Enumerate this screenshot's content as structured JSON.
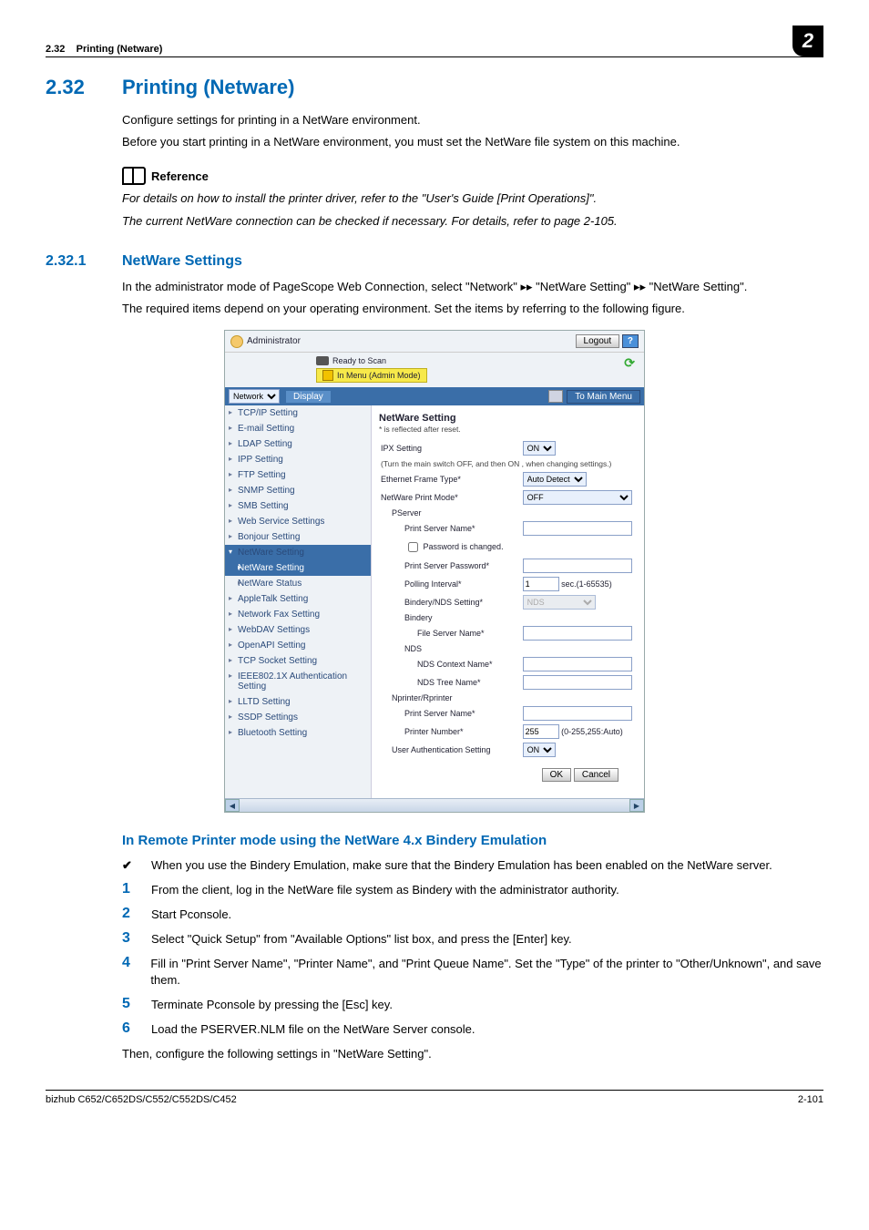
{
  "header": {
    "section_no": "2.32",
    "section_name": "Printing (Netware)",
    "chapter_badge": "2"
  },
  "h1": {
    "num": "2.32",
    "title": "Printing (Netware)"
  },
  "intro": {
    "p1": "Configure settings for printing in a NetWare environment.",
    "p2": "Before you start printing in a NetWare environment, you must set the NetWare file system on this machine."
  },
  "reference": {
    "label": "Reference",
    "l1": "For details on how to install the printer driver, refer to the \"User's Guide [Print Operations]\".",
    "l2": "The current NetWare connection can be checked if necessary. For details, refer to page 2-105."
  },
  "h2": {
    "num": "2.32.1",
    "title": "NetWare Settings"
  },
  "sub_intro": {
    "p1a": "In the administrator mode of PageScope Web Connection, select \"Network\" ",
    "arr": "▸▸",
    "p1b": " \"NetWare Setting\" ",
    "p1c": " \"NetWare Setting\".",
    "p2": "The required items depend on your operating environment. Set the items by referring to the following figure."
  },
  "ui": {
    "admin_label": "Administrator",
    "logout": "Logout",
    "help": "?",
    "ready": "Ready to Scan",
    "menu_mode": "In Menu (Admin Mode)",
    "dropdown_sel": "Network",
    "display_btn": "Display",
    "to_main": "To Main Menu",
    "nav": {
      "tcpip": "TCP/IP Setting",
      "email": "E-mail Setting",
      "ldap": "LDAP Setting",
      "ipp": "IPP Setting",
      "ftp": "FTP Setting",
      "snmp": "SNMP Setting",
      "smb": "SMB Setting",
      "webserv": "Web Service Settings",
      "bonjour": "Bonjour Setting",
      "netware": "NetWare Setting",
      "netware_sub": "NetWare Setting",
      "netware_status": "NetWare Status",
      "appletalk": "AppleTalk Setting",
      "netfax": "Network Fax Setting",
      "webdav": "WebDAV Settings",
      "openapi": "OpenAPI Setting",
      "tcpsock": "TCP Socket Setting",
      "ieee": "IEEE802.1X Authentication Setting",
      "lltd": "LLTD Setting",
      "ssdp": "SSDP Settings",
      "bluetooth": "Bluetooth Setting"
    },
    "form": {
      "title": "NetWare Setting",
      "note": "* is reflected after reset.",
      "ipx": "IPX Setting",
      "ipx_val": "ON",
      "ipx_hint": "(Turn the main switch OFF, and then ON , when changing settings.)",
      "eth": "Ethernet Frame Type*",
      "eth_val": "Auto Detect",
      "mode": "NetWare Print Mode*",
      "mode_val": "OFF",
      "pserver": "PServer",
      "psname": "Print Server Name*",
      "pwchanged": "Password is changed.",
      "pspass": "Print Server Password*",
      "poll": "Polling Interval*",
      "poll_val": "1",
      "poll_hint": "sec.(1-65535)",
      "bindnds": "Bindery/NDS Setting*",
      "bindnds_val": "NDS",
      "bindery": "Bindery",
      "fsname": "File Server Name*",
      "nds": "NDS",
      "ndsctx": "NDS Context Name*",
      "ndstree": "NDS Tree Name*",
      "nprinter": "Nprinter/Rprinter",
      "psname2": "Print Server Name*",
      "prnum": "Printer Number*",
      "prnum_val": "255",
      "prnum_hint": "(0-255,255:Auto)",
      "uauth": "User Authentication Setting",
      "uauth_val": "ON",
      "ok": "OK",
      "cancel": "Cancel"
    }
  },
  "h3": "In Remote Printer mode using the NetWare 4.x Bindery Emulation",
  "check": "When you use the Bindery Emulation, make sure that the Bindery Emulation has been enabled on the NetWare server.",
  "steps": {
    "s1": "From the client, log in the NetWare file system as Bindery with the administrator authority.",
    "s2": "Start Pconsole.",
    "s3": "Select \"Quick Setup\" from \"Available Options\" list box, and press the [Enter] key.",
    "s4": "Fill in \"Print Server Name\", \"Printer Name\", and \"Print Queue Name\". Set the \"Type\" of the printer to \"Other/Unknown\", and save them.",
    "s5": "Terminate Pconsole by pressing the [Esc] key.",
    "s6": "Load the PSERVER.NLM file on the NetWare Server console."
  },
  "final": "Then, configure the following settings in \"NetWare Setting\".",
  "footer": {
    "left": "bizhub C652/C652DS/C552/C552DS/C452",
    "right": "2-101"
  }
}
